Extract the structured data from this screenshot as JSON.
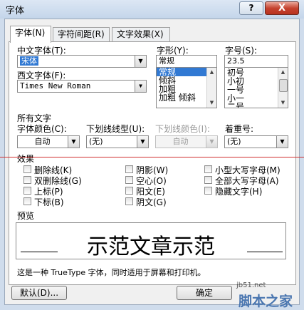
{
  "window": {
    "title": "字体",
    "help_label": "?",
    "close_label": "X"
  },
  "tabs": [
    {
      "label": "字体(N)"
    },
    {
      "label": "字符间距(R)"
    },
    {
      "label": "文字效果(X)"
    }
  ],
  "font": {
    "chinese_label": "中文字体(T):",
    "chinese_value": "宋体",
    "western_label": "西文字体(F):",
    "western_value": "Times New Roman",
    "style_label": "字形(Y):",
    "style_value": "常规",
    "style_options": [
      "常规",
      "倾斜",
      "加粗",
      "加粗 倾斜"
    ],
    "size_label": "字号(S):",
    "size_value": "23.5",
    "size_options": [
      "初号",
      "小初",
      "一号",
      "小一",
      "二号"
    ]
  },
  "all_text": {
    "section_label": "所有文字",
    "color_label": "字体颜色(C):",
    "color_value": "自动",
    "underline_label": "下划线线型(U):",
    "underline_value": "(无)",
    "underline_color_label": "下划线颜色(I):",
    "underline_color_value": "自动",
    "emphasis_label": "着重号:",
    "emphasis_value": "(无)"
  },
  "effects": {
    "section_label": "效果",
    "items": [
      {
        "label": "删除线(K)"
      },
      {
        "label": "双删除线(G)"
      },
      {
        "label": "上标(P)"
      },
      {
        "label": "下标(B)"
      },
      {
        "label": "阴影(W)"
      },
      {
        "label": "空心(O)"
      },
      {
        "label": "阳文(E)"
      },
      {
        "label": "阴文(G)"
      },
      {
        "label": "小型大写字母(M)"
      },
      {
        "label": "全部大写字母(A)"
      },
      {
        "label": "隐藏文字(H)"
      }
    ]
  },
  "preview": {
    "section_label": "预览",
    "sample_text": "示范文章示范",
    "note": "这是一种 TrueType 字体，同时适用于屏幕和打印机。"
  },
  "buttons": {
    "default_label": "默认(D)...",
    "ok_label": "确定"
  },
  "watermark": {
    "site": "jb51.net",
    "name": "脚本之家"
  }
}
